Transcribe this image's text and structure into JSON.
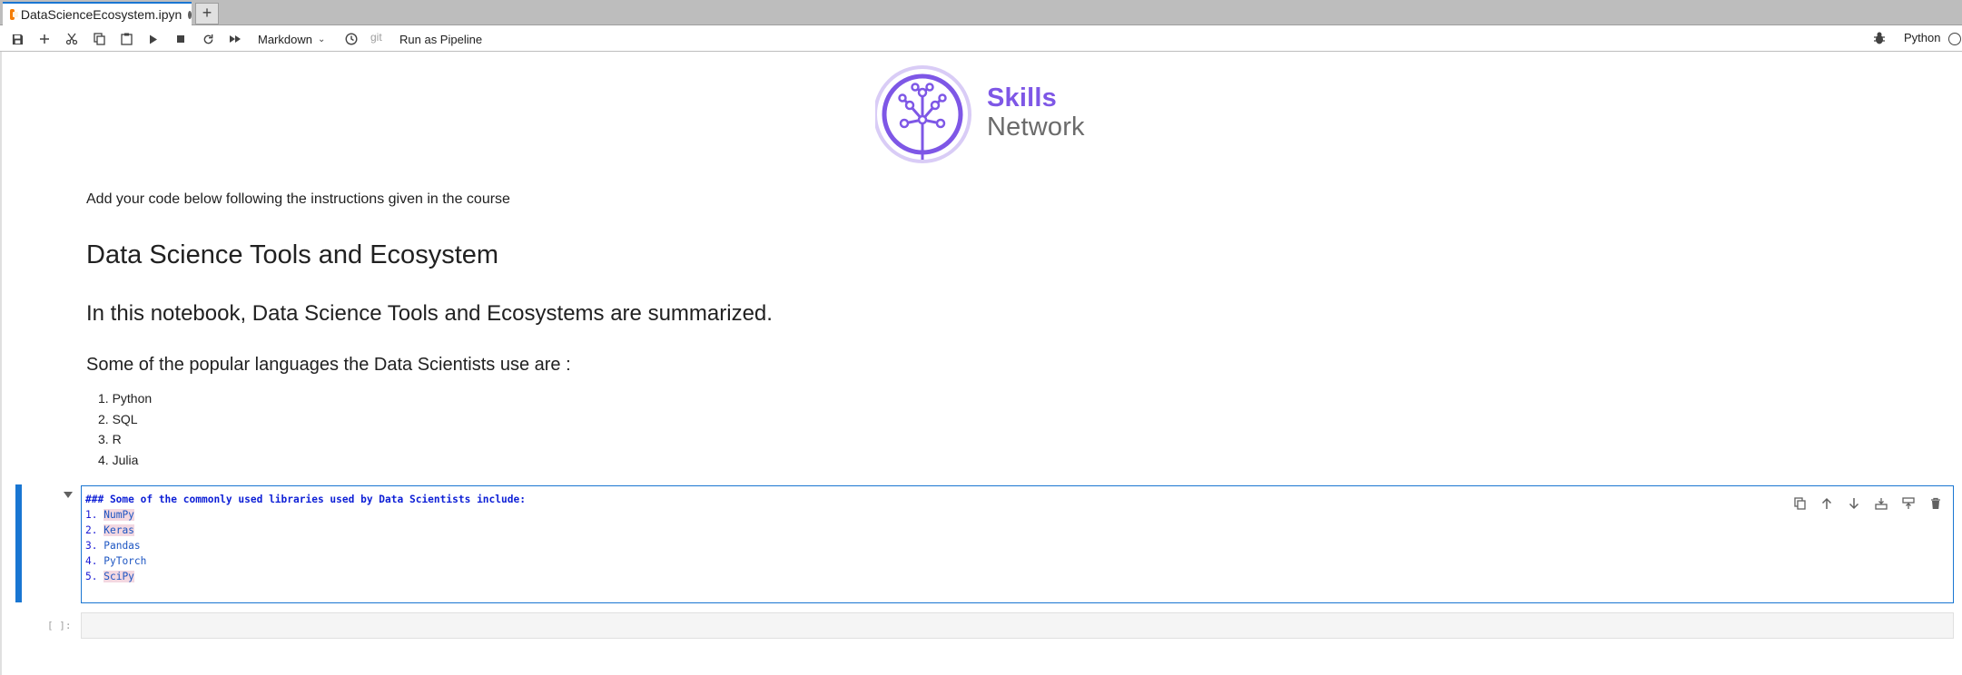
{
  "tab": {
    "title": "DataScienceEcosystem.ipyn",
    "new_tab_label": "+"
  },
  "toolbar": {
    "buttons": [
      {
        "name": "save-button",
        "icon": "save-icon"
      },
      {
        "name": "insert-cell-button",
        "icon": "plus-icon"
      },
      {
        "name": "cut-button",
        "icon": "scissors-icon"
      },
      {
        "name": "copy-button",
        "icon": "copy-icon"
      },
      {
        "name": "paste-button",
        "icon": "paste-icon"
      },
      {
        "name": "run-button",
        "icon": "play-icon"
      },
      {
        "name": "interrupt-button",
        "icon": "stop-icon"
      },
      {
        "name": "restart-button",
        "icon": "refresh-icon"
      },
      {
        "name": "restart-run-all-button",
        "icon": "fast-forward-icon"
      }
    ],
    "cell_type": "Markdown",
    "git_label": "git",
    "pipeline_label": "Run as Pipeline",
    "kernel_name": "Python"
  },
  "logo": {
    "line1": "Skills",
    "line2": "Network",
    "accent": "#7e57e6"
  },
  "notebook": {
    "intro": "Add your code below following the instructions given in the course",
    "title": "Data Science Tools and Ecosystem",
    "summary": "In this notebook, Data Science Tools and Ecosystems are summarized.",
    "languages_heading": "Some of the popular languages the Data Scientists use are :",
    "languages": [
      "1. Python",
      "2. SQL",
      "3. R",
      "4. Julia"
    ],
    "active_cell": {
      "heading": "### Some of the commonly used libraries used by Data Scientists include:",
      "items": [
        {
          "num": "1.",
          "name": "NumPy",
          "highlight": true
        },
        {
          "num": "2.",
          "name": "Keras",
          "highlight": true
        },
        {
          "num": "3.",
          "name": "Pandas",
          "highlight": false
        },
        {
          "num": "4.",
          "name": "PyTorch",
          "highlight": false
        },
        {
          "num": "5.",
          "name": "SciPy",
          "highlight": true
        }
      ]
    },
    "empty_prompt": "[ ]:"
  }
}
